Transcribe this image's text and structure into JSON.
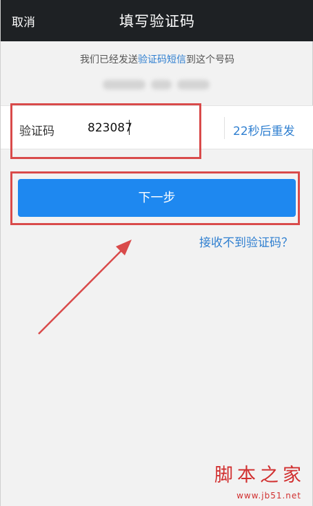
{
  "header": {
    "cancel_label": "取消",
    "title": "填写验证码"
  },
  "info": {
    "prefix": "我们已经发送",
    "link_text": "验证码短信",
    "suffix": "到这个号码"
  },
  "code": {
    "label": "验证码",
    "value": "823087",
    "resend_label": "22秒后重发"
  },
  "next_button_label": "下一步",
  "help_link": "接收不到验证码？",
  "watermark": {
    "main": "脚本之家",
    "sub": "www.jb51.net"
  },
  "colors": {
    "accent": "#1e88f0",
    "link": "#2f7fd0",
    "highlight": "#d94a4a"
  }
}
